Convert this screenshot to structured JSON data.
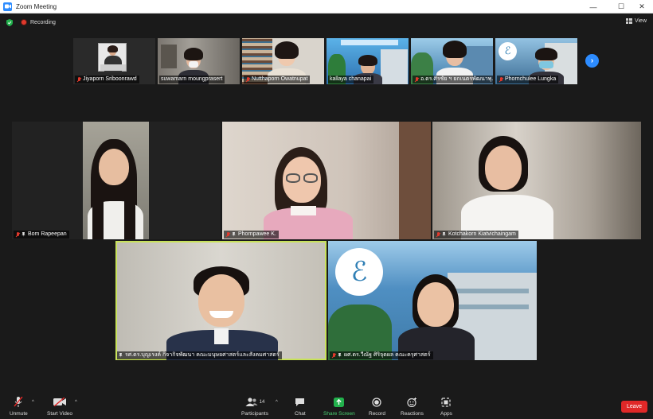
{
  "window": {
    "title": "Zoom Meeting",
    "minimize": "—",
    "maximize": "☐",
    "close": "✕"
  },
  "meeting": {
    "recording_label": "Recording",
    "view_label": "View"
  },
  "strip": [
    {
      "name": "Jiyaporn Sriboonrawd",
      "muted": true
    },
    {
      "name": "suwamarn moungprasert",
      "muted": false
    },
    {
      "name": "Nutthaporn Owatnupat",
      "muted": true
    },
    {
      "name": "kallaya chanapai",
      "muted": false
    },
    {
      "name": "อ.ดร.ศิรชัย ฯ ยกเนตรพัฒนาพุ...",
      "muted": true
    },
    {
      "name": "Phornchulee Lungka",
      "muted": true
    }
  ],
  "strip_next": "›",
  "gallery": [
    {
      "name": "Bom Rapeepan"
    },
    {
      "name": "Phornpawee K."
    },
    {
      "name": "Kotchakorn Kiatvichaingam"
    },
    {
      "name": "รศ.ดร.บุญเรงค์ กิจากิจพัฒนา คณะมนุษยศาสตร์และสังคมศาสตร์",
      "speaking": true
    },
    {
      "name": "ผศ.ดร.วีณัฐ ศิริจุดผล คณะครุศาสตร์"
    }
  ],
  "toolbar": {
    "unmute": "Unmute",
    "start_video": "Start Video",
    "participants": "Participants",
    "participants_count": "14",
    "chat": "Chat",
    "share_screen": "Share Screen",
    "record": "Record",
    "reactions": "Reactions",
    "apps": "Apps",
    "leave": "Leave"
  },
  "colors": {
    "accent": "#2d8cff",
    "share": "#22b14c",
    "leave": "#e02828",
    "active_speaker": "#c8e25a",
    "background": "#1a1a1a"
  }
}
